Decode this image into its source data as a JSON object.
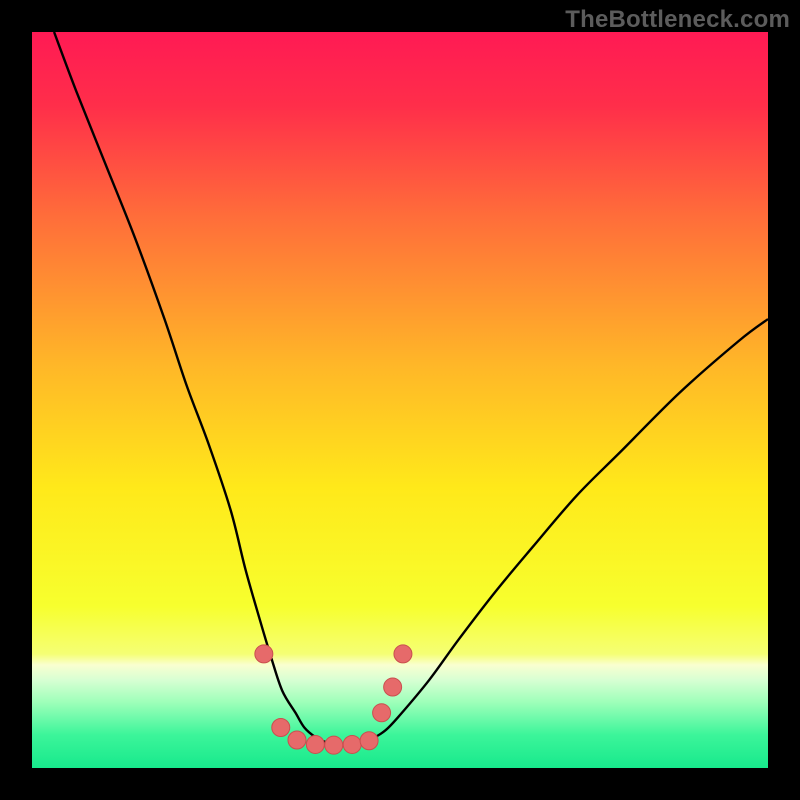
{
  "watermark": "TheBottleneck.com",
  "colors": {
    "frame": "#000000",
    "gradient_stops": [
      {
        "offset": 0.0,
        "color": "#ff1a54"
      },
      {
        "offset": 0.1,
        "color": "#ff2e4a"
      },
      {
        "offset": 0.25,
        "color": "#ff6d3a"
      },
      {
        "offset": 0.45,
        "color": "#ffb628"
      },
      {
        "offset": 0.62,
        "color": "#ffe91a"
      },
      {
        "offset": 0.78,
        "color": "#f7ff2e"
      },
      {
        "offset": 0.845,
        "color": "#f5ff74"
      },
      {
        "offset": 0.86,
        "color": "#f9ffd0"
      },
      {
        "offset": 0.88,
        "color": "#d8ffd3"
      },
      {
        "offset": 0.91,
        "color": "#9fffba"
      },
      {
        "offset": 0.955,
        "color": "#3cf59a"
      },
      {
        "offset": 1.0,
        "color": "#17e98c"
      }
    ],
    "curve": "#000000",
    "markers_fill": "#e66a6a",
    "markers_stroke": "#c94f4f"
  },
  "chart_data": {
    "type": "line",
    "title": "",
    "xlabel": "",
    "ylabel": "",
    "xlim": [
      0,
      100
    ],
    "ylim": [
      0,
      100
    ],
    "note": "Bottleneck-style V curve. No numeric axis ticks shown; values estimated from pixel positions.",
    "series": [
      {
        "name": "bottleneck-curve",
        "x": [
          3,
          6,
          10,
          14,
          18,
          21,
          24,
          27,
          29,
          31,
          32.5,
          34,
          35.8,
          37,
          38.5,
          40,
          42,
          44,
          46,
          48,
          50,
          54,
          58,
          63,
          68,
          74,
          80,
          88,
          96,
          100
        ],
        "y": [
          100,
          92,
          82,
          72,
          61,
          52,
          44,
          35,
          27,
          20,
          15,
          10.5,
          7.5,
          5.5,
          4.2,
          3.5,
          3.2,
          3.3,
          3.9,
          5.1,
          7.2,
          12,
          17.5,
          24,
          30,
          37,
          43,
          51,
          58,
          61
        ]
      }
    ],
    "markers": [
      {
        "x": 31.5,
        "y": 15.5
      },
      {
        "x": 33.8,
        "y": 5.5
      },
      {
        "x": 36.0,
        "y": 3.8
      },
      {
        "x": 38.5,
        "y": 3.2
      },
      {
        "x": 41.0,
        "y": 3.1
      },
      {
        "x": 43.5,
        "y": 3.2
      },
      {
        "x": 45.8,
        "y": 3.7
      },
      {
        "x": 47.5,
        "y": 7.5
      },
      {
        "x": 49.0,
        "y": 11.0
      },
      {
        "x": 50.4,
        "y": 15.5
      }
    ]
  }
}
